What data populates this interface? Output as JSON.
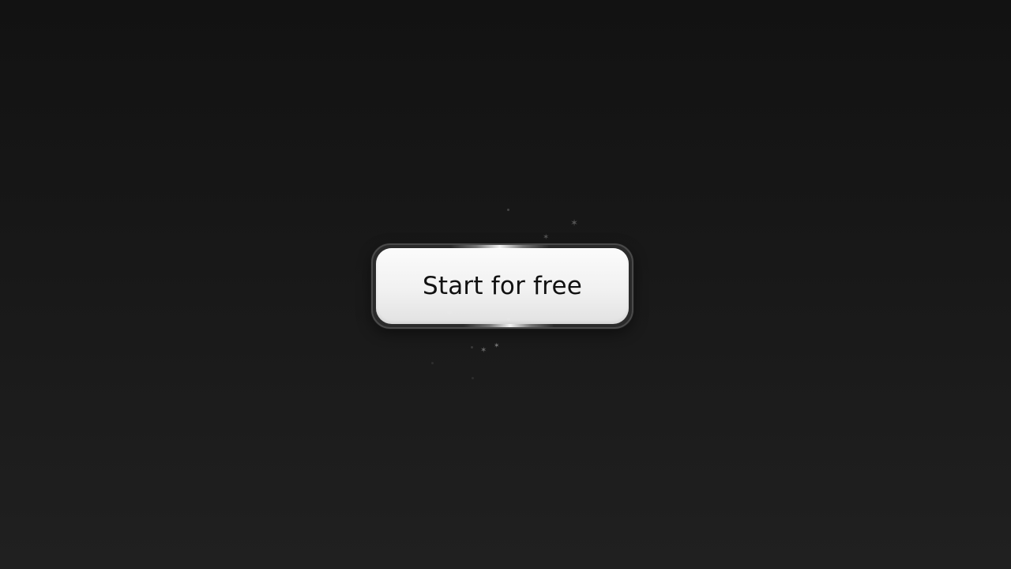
{
  "cta": {
    "label": "Start for free"
  },
  "decor": {
    "sparkle_icon": "star-sparkle-icon",
    "colors": {
      "background_top": "#121212",
      "background_bottom": "#202020",
      "button_face": "#f1f1f1",
      "button_text": "#111111",
      "frame": "#2a2a2a"
    }
  }
}
